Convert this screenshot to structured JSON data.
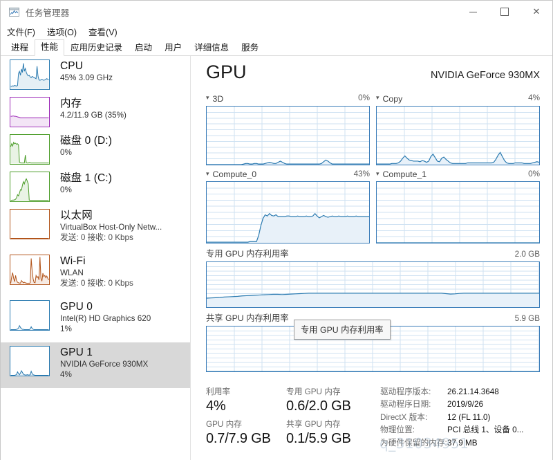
{
  "window": {
    "title": "任务管理器",
    "icon": "task-manager-icon",
    "minimize": "—",
    "maximize": "□",
    "close": "✕"
  },
  "menu": {
    "items": [
      {
        "label": "文件(F)"
      },
      {
        "label": "选项(O)"
      },
      {
        "label": "查看(V)"
      }
    ]
  },
  "tabs": {
    "items": [
      {
        "label": "进程",
        "active": false
      },
      {
        "label": "性能",
        "active": true
      },
      {
        "label": "应用历史记录",
        "active": false
      },
      {
        "label": "启动",
        "active": false
      },
      {
        "label": "用户",
        "active": false
      },
      {
        "label": "详细信息",
        "active": false
      },
      {
        "label": "服务",
        "active": false
      }
    ]
  },
  "sidebar": {
    "items": [
      {
        "title": "CPU",
        "sub1": "45%  3.09 GHz",
        "sub2": "",
        "color": "#2a7ab0",
        "selected": false
      },
      {
        "title": "内存",
        "sub1": "4.2/11.9 GB (35%)",
        "sub2": "",
        "color": "#9b26b6",
        "selected": false
      },
      {
        "title": "磁盘 0 (D:)",
        "sub1": "0%",
        "sub2": "",
        "color": "#4a9c27",
        "selected": false
      },
      {
        "title": "磁盘 1 (C:)",
        "sub1": "0%",
        "sub2": "",
        "color": "#4a9c27",
        "selected": false
      },
      {
        "title": "以太网",
        "sub1": "VirtualBox Host-Only Netw...",
        "sub2": "发送: 0 接收: 0 Kbps",
        "color": "#b2541a",
        "selected": false
      },
      {
        "title": "Wi-Fi",
        "sub1": "WLAN",
        "sub2": "发送: 0 接收: 0 Kbps",
        "color": "#b2541a",
        "selected": false
      },
      {
        "title": "GPU 0",
        "sub1": "Intel(R) HD Graphics 620",
        "sub2": "1%",
        "color": "#2a7ab0",
        "selected": false
      },
      {
        "title": "GPU 1",
        "sub1": "NVIDIA GeForce 930MX",
        "sub2": "4%",
        "color": "#2a7ab0",
        "selected": true
      }
    ]
  },
  "main": {
    "title": "GPU",
    "model": "NVIDIA GeForce 930MX",
    "engines": [
      {
        "name": "3D",
        "value": "0%"
      },
      {
        "name": "Copy",
        "value": "4%"
      },
      {
        "name": "Compute_0",
        "value": "43%"
      },
      {
        "name": "Compute_1",
        "value": "0%"
      }
    ],
    "memory_graphs": [
      {
        "label": "专用 GPU 内存利用率",
        "max": "2.0 GB"
      },
      {
        "label": "共享 GPU 内存利用率",
        "max": "5.9 GB"
      }
    ],
    "tooltip": "专用 GPU 内存利用率"
  },
  "stats": {
    "left": [
      {
        "label": "利用率",
        "value": "4%"
      },
      {
        "label": "GPU 内存",
        "value": "0.7/7.9 GB"
      }
    ],
    "middle": [
      {
        "label": "专用 GPU 内存",
        "value": "0.6/2.0 GB"
      },
      {
        "label": "共享 GPU 内存",
        "value": "0.1/5.9 GB"
      }
    ],
    "info": [
      {
        "key": "驱动程序版本:",
        "value": "26.21.14.3648"
      },
      {
        "key": "驱动程序日期:",
        "value": "2019/9/26"
      },
      {
        "key": "DirectX 版本:",
        "value": "12 (FL 11.0)"
      },
      {
        "key": "物理位置:",
        "value": "PCI 总线 1、设备 0..."
      },
      {
        "key": "为硬件保留的内存:",
        "value": "37.9 MB"
      }
    ]
  },
  "watermark": "q_31034951",
  "chart_data": [
    {
      "type": "area",
      "title": "3D",
      "ylabel": "utilization %",
      "ylim": [
        0,
        100
      ],
      "current": 0,
      "grid": true,
      "values": [
        0,
        0,
        0,
        0,
        0,
        0,
        0,
        0,
        0,
        0,
        0,
        0,
        0,
        0,
        0,
        0,
        0,
        1,
        2,
        2,
        1,
        1,
        2,
        2,
        1,
        1,
        1,
        2,
        3,
        4,
        3,
        2,
        2,
        4,
        6,
        4,
        2,
        1,
        1,
        1,
        1,
        1,
        1,
        1,
        1,
        1,
        1,
        1,
        1,
        1,
        1,
        1,
        1,
        2,
        5,
        8,
        6,
        3,
        1,
        1,
        1,
        1,
        1,
        1,
        1,
        1,
        1,
        1,
        1,
        1,
        1,
        1,
        1,
        1,
        1,
        1
      ]
    },
    {
      "type": "area",
      "title": "Copy",
      "ylabel": "utilization %",
      "ylim": [
        0,
        100
      ],
      "current": 4,
      "grid": true,
      "values": [
        1,
        1,
        1,
        1,
        1,
        1,
        1,
        2,
        2,
        2,
        3,
        6,
        11,
        15,
        11,
        8,
        7,
        6,
        6,
        6,
        5,
        7,
        6,
        4,
        6,
        14,
        18,
        12,
        6,
        5,
        11,
        13,
        9,
        6,
        3,
        2,
        2,
        2,
        2,
        2,
        2,
        2,
        3,
        3,
        3,
        3,
        3,
        3,
        3,
        3,
        3,
        3,
        3,
        3,
        4,
        9,
        16,
        21,
        14,
        7,
        3,
        2,
        2,
        2,
        3,
        3,
        3,
        3,
        2,
        2,
        2,
        2,
        3,
        4,
        5,
        4
      ]
    },
    {
      "type": "area",
      "title": "Compute_0",
      "ylabel": "utilization %",
      "ylim": [
        0,
        100
      ],
      "current": 43,
      "grid": true,
      "values": [
        1,
        1,
        1,
        1,
        1,
        1,
        1,
        1,
        1,
        1,
        1,
        1,
        1,
        1,
        1,
        1,
        1,
        1,
        1,
        1,
        2,
        2,
        2,
        2,
        12,
        28,
        40,
        46,
        44,
        48,
        45,
        44,
        46,
        43,
        43,
        43,
        43,
        44,
        44,
        43,
        43,
        43,
        44,
        43,
        43,
        43,
        44,
        43,
        43,
        44,
        48,
        44,
        41,
        43,
        45,
        43,
        42,
        43,
        44,
        43,
        43,
        44,
        43,
        43,
        43,
        44,
        43,
        43,
        43,
        44,
        43,
        43,
        43,
        43,
        43,
        43
      ]
    },
    {
      "type": "area",
      "title": "Compute_1",
      "ylabel": "utilization %",
      "ylim": [
        0,
        100
      ],
      "current": 0,
      "grid": true,
      "values": [
        0,
        0,
        0,
        0,
        0,
        0,
        0,
        0,
        0,
        0,
        0,
        0,
        0,
        0,
        0,
        0,
        0,
        0,
        0,
        0,
        0,
        0,
        0,
        0,
        0,
        0,
        0,
        0,
        0,
        0,
        0,
        0,
        0,
        0,
        0,
        0,
        0,
        0,
        0,
        0,
        0,
        0,
        0,
        0,
        0,
        0,
        0,
        0,
        0,
        0,
        0,
        0,
        0,
        0,
        0,
        0,
        0,
        0,
        0,
        0,
        0,
        0,
        0,
        0,
        0,
        0,
        0,
        0,
        0,
        0,
        0,
        0,
        0,
        0,
        0,
        0
      ]
    },
    {
      "type": "area",
      "title": "专用 GPU 内存利用率",
      "ylabel": "GB",
      "ylim": [
        0,
        2.0
      ],
      "current": 0.6,
      "grid": true,
      "values": [
        0.4,
        0.41,
        0.42,
        0.43,
        0.45,
        0.46,
        0.47,
        0.48,
        0.5,
        0.51,
        0.52,
        0.53,
        0.54,
        0.55,
        0.56,
        0.57,
        0.57,
        0.56,
        0.57,
        0.58,
        0.59,
        0.6,
        0.61,
        0.62,
        0.62,
        0.62,
        0.62,
        0.62,
        0.62,
        0.62,
        0.62,
        0.62,
        0.62,
        0.62,
        0.62,
        0.62,
        0.62,
        0.62,
        0.62,
        0.62,
        0.62,
        0.62,
        0.62,
        0.62,
        0.62,
        0.62,
        0.62,
        0.62,
        0.62,
        0.62,
        0.62,
        0.62,
        0.62,
        0.62,
        0.6,
        0.58,
        0.59,
        0.61,
        0.62,
        0.62,
        0.62,
        0.62,
        0.62,
        0.62,
        0.62,
        0.62,
        0.62,
        0.62,
        0.62,
        0.62,
        0.62,
        0.62,
        0.62,
        0.62,
        0.62,
        0.62
      ]
    },
    {
      "type": "area",
      "title": "共享 GPU 内存利用率",
      "ylabel": "GB",
      "ylim": [
        0,
        5.9
      ],
      "current": 0.1,
      "grid": true,
      "values": [
        0,
        0,
        0,
        0,
        0,
        0,
        0,
        0,
        0,
        0,
        0,
        0,
        0,
        0,
        0,
        0,
        0,
        0,
        0,
        0,
        0,
        0,
        0,
        0,
        0,
        0,
        0,
        0,
        0,
        0,
        0,
        0,
        0,
        0,
        0,
        0,
        0,
        0,
        0,
        0,
        0,
        0,
        0,
        0,
        0,
        0,
        0,
        0,
        0,
        0,
        0,
        0,
        0,
        0,
        0,
        0,
        0,
        0,
        0,
        0,
        0,
        0,
        0,
        0,
        0,
        0,
        0,
        0,
        0,
        0,
        0,
        0,
        0,
        0,
        0,
        0
      ]
    }
  ],
  "sidebar_sparklines": {
    "cpu": [
      10,
      9,
      11,
      10,
      12,
      11,
      10,
      12,
      55,
      62,
      48,
      70,
      58,
      90,
      62,
      72,
      58,
      50,
      46,
      48,
      42,
      40,
      44,
      42,
      40,
      38,
      36,
      80,
      45,
      32,
      30,
      32,
      34,
      32,
      30,
      32,
      34,
      36,
      34,
      33
    ],
    "memory": [
      35,
      35,
      36,
      36,
      35,
      35,
      34,
      33,
      32,
      31,
      30,
      30,
      30,
      30,
      30,
      30,
      30,
      30,
      30,
      30,
      30,
      30,
      30,
      30,
      30,
      30,
      30,
      30,
      30,
      30,
      30,
      30,
      30,
      30,
      30,
      30,
      30,
      30,
      30,
      30
    ],
    "disk0": [
      60,
      70,
      62,
      75,
      70,
      72,
      68,
      70,
      66,
      5,
      3,
      2,
      2,
      2,
      2,
      30,
      3,
      2,
      2,
      4,
      3,
      2,
      2,
      2,
      2,
      2,
      2,
      2,
      2,
      2,
      2,
      2,
      2,
      2,
      2,
      2,
      2,
      2,
      2,
      2
    ],
    "disk1": [
      2,
      2,
      3,
      3,
      4,
      6,
      12,
      22,
      18,
      28,
      40,
      38,
      55,
      68,
      60,
      72,
      78,
      70,
      60,
      3,
      2,
      2,
      2,
      2,
      2,
      2,
      2,
      2,
      2,
      2,
      2,
      2,
      2,
      2,
      2,
      2,
      2,
      2,
      2,
      2
    ],
    "eth": [
      0,
      0,
      0,
      0,
      0,
      0,
      0,
      0,
      0,
      0,
      0,
      0,
      0,
      0,
      0,
      0,
      0,
      0,
      0,
      0,
      0,
      0,
      0,
      0,
      0,
      0,
      0,
      0,
      0,
      0,
      0,
      0,
      0,
      0,
      0,
      0,
      0,
      0,
      0,
      0
    ],
    "wifi": [
      2,
      25,
      40,
      20,
      8,
      30,
      12,
      6,
      4,
      3,
      3,
      12,
      8,
      4,
      6,
      4,
      3,
      2,
      3,
      2,
      4,
      90,
      45,
      18,
      5,
      4,
      30,
      22,
      26,
      14,
      95,
      20,
      10,
      38,
      26,
      30,
      22,
      28,
      20,
      14
    ],
    "gpu0": [
      0,
      0,
      0,
      0,
      0,
      0,
      1,
      2,
      6,
      14,
      8,
      3,
      1,
      1,
      0,
      0,
      0,
      0,
      0,
      0,
      2,
      10,
      4,
      1,
      0,
      0,
      0,
      0,
      0,
      0,
      0,
      0,
      0,
      0,
      0,
      0,
      0,
      0,
      0,
      0
    ],
    "gpu1": [
      0,
      0,
      0,
      0,
      0,
      1,
      3,
      12,
      6,
      2,
      8,
      16,
      10,
      4,
      2,
      1,
      1,
      2,
      1,
      1,
      2,
      14,
      6,
      2,
      1,
      0,
      0,
      0,
      0,
      0,
      0,
      0,
      0,
      0,
      0,
      0,
      0,
      0,
      0,
      0
    ]
  }
}
